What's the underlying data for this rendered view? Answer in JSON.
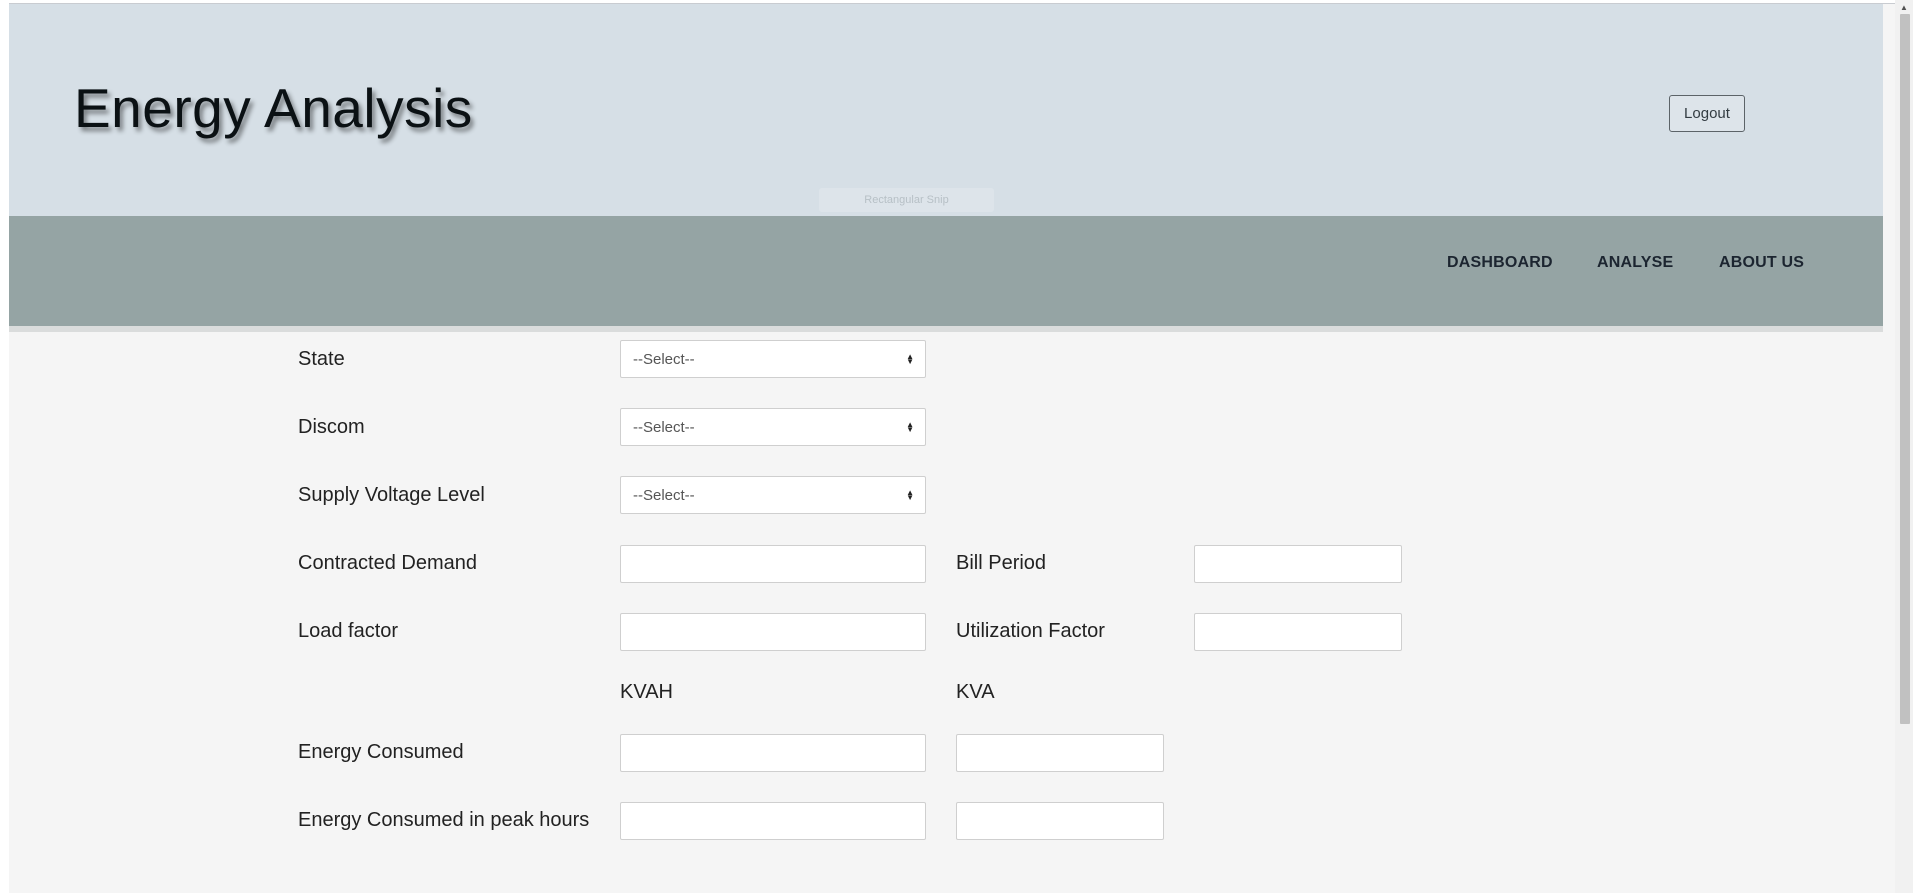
{
  "header": {
    "title": "Energy Analysis",
    "logout_label": "Logout",
    "tooltip_text": "Rectangular Snip"
  },
  "nav": {
    "items": [
      {
        "label": "DASHBOARD"
      },
      {
        "label": "ANALYSE"
      },
      {
        "label": "ABOUT US"
      }
    ]
  },
  "form": {
    "state": {
      "label": "State",
      "value": "--Select--"
    },
    "discom": {
      "label": "Discom",
      "value": "--Select--"
    },
    "supply_voltage": {
      "label": "Supply Voltage Level",
      "value": "--Select--"
    },
    "contracted_demand": {
      "label": "Contracted Demand",
      "value": ""
    },
    "bill_period": {
      "label": "Bill Period",
      "value": ""
    },
    "load_factor": {
      "label": "Load factor",
      "value": ""
    },
    "utilization_factor": {
      "label": "Utilization Factor",
      "value": ""
    },
    "units": {
      "kvah": "KVAH",
      "kva": "KVA"
    },
    "energy_consumed": {
      "label": "Energy Consumed",
      "kvah_value": "",
      "kva_value": ""
    },
    "energy_peak": {
      "label": "Energy Consumed in peak hours",
      "kvah_value": "",
      "kva_value": ""
    }
  },
  "icons": {
    "select_arrow": "sort-arrows-icon",
    "scroll_up": "triangle-up-icon"
  },
  "colors": {
    "header_bg": "#d6dfe6",
    "nav_bg": "#95a4a4",
    "page_bg": "#f5f5f5"
  }
}
